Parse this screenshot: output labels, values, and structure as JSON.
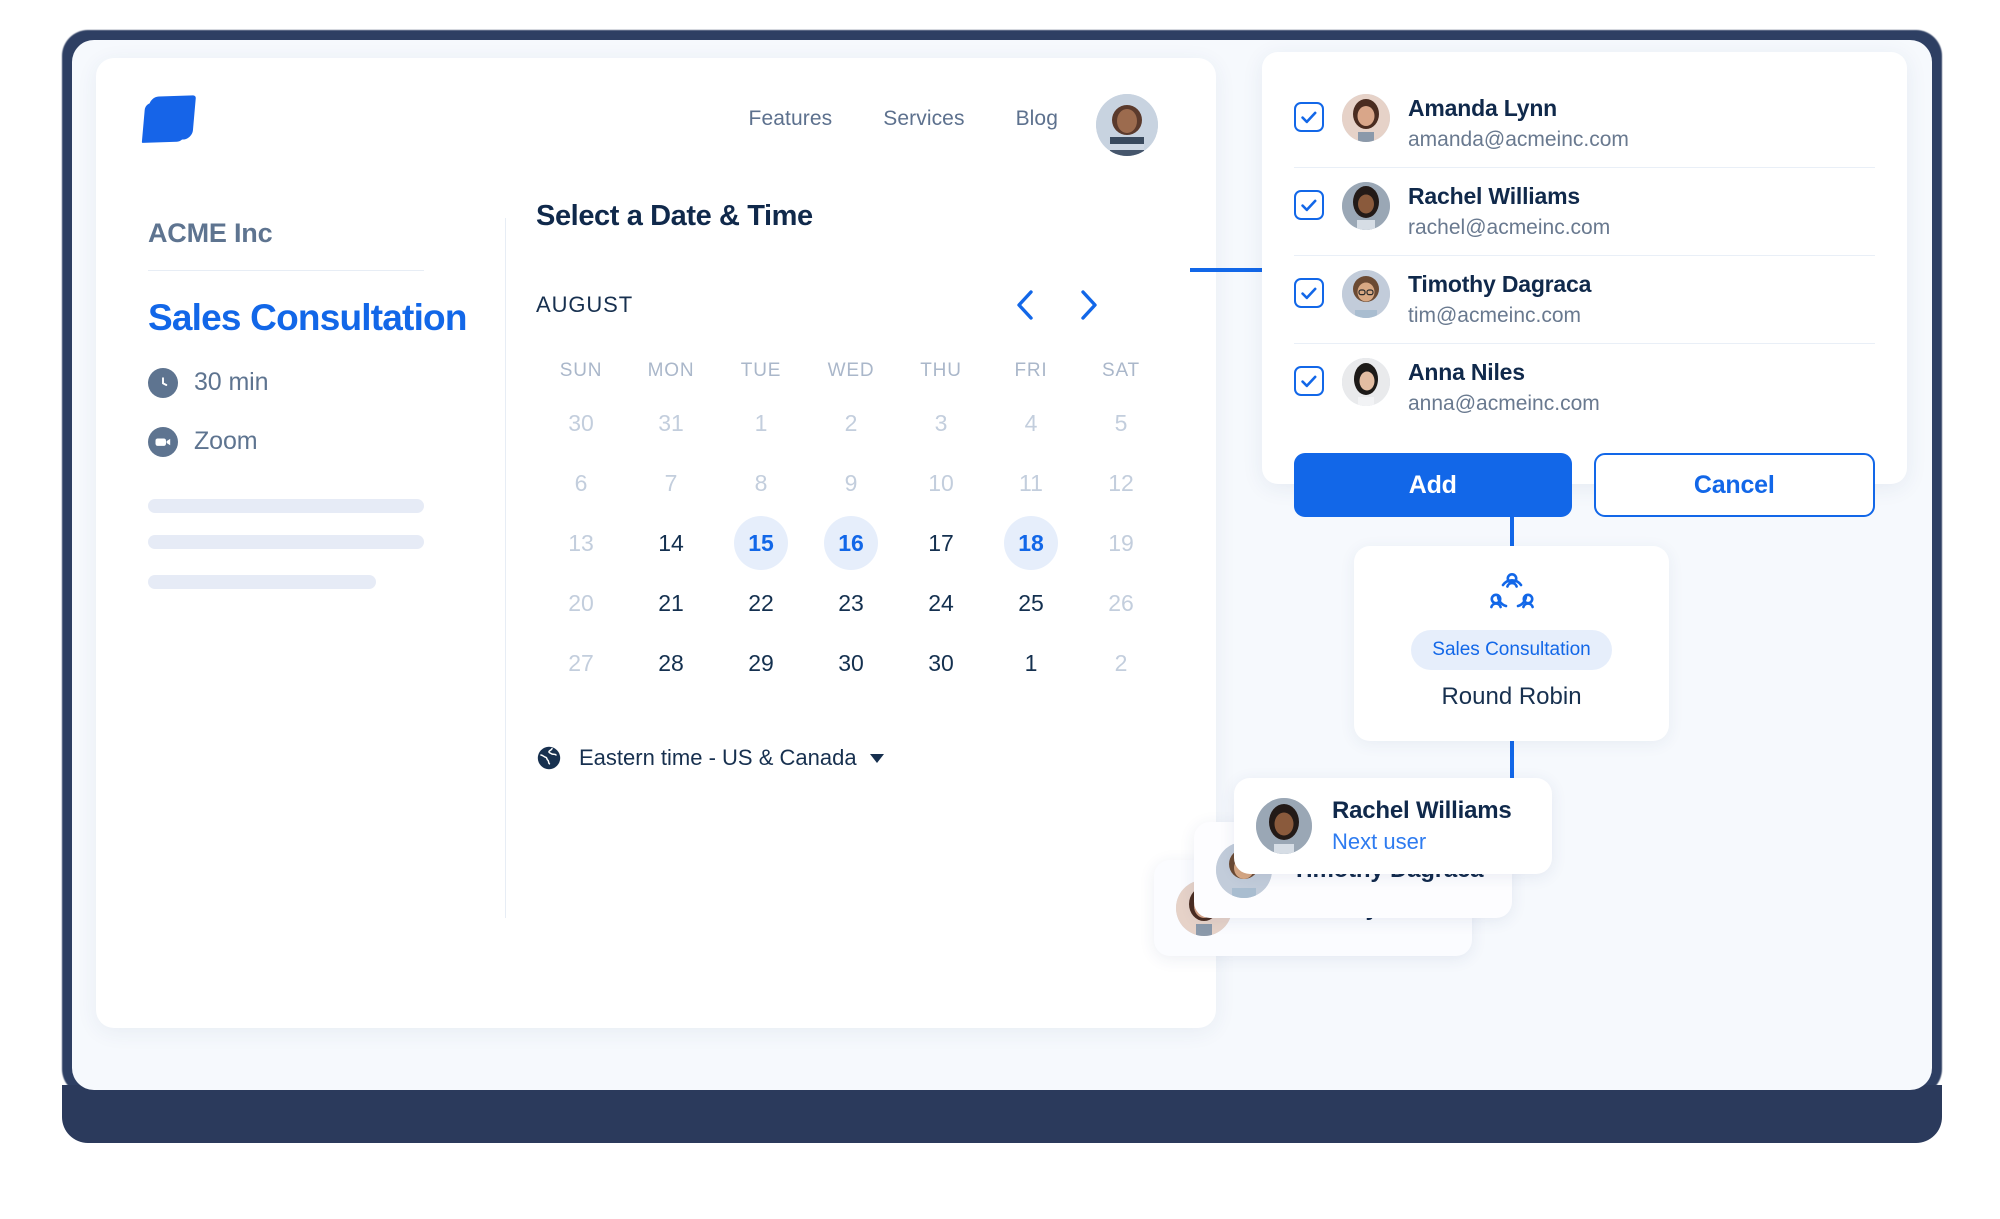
{
  "header": {
    "logo_icon": "brand-logo-icon",
    "nav": [
      {
        "label": "Features"
      },
      {
        "label": "Services"
      },
      {
        "label": "Blog"
      }
    ],
    "avatar_alt": "user-avatar"
  },
  "event": {
    "organization": "ACME Inc",
    "title": "Sales Consultation",
    "duration_icon": "clock-icon",
    "duration": "30 min",
    "location_icon": "video-camera-icon",
    "location": "Zoom"
  },
  "scheduler": {
    "heading": "Select a Date & Time",
    "month": "AUGUST",
    "prev_icon": "chevron-left-icon",
    "next_icon": "chevron-right-icon",
    "weekdays": [
      "SUN",
      "MON",
      "TUE",
      "WED",
      "THU",
      "FRI",
      "SAT"
    ],
    "weeks": [
      [
        {
          "d": "30",
          "state": "muted"
        },
        {
          "d": "31",
          "state": "muted"
        },
        {
          "d": "1",
          "state": "muted"
        },
        {
          "d": "2",
          "state": "muted"
        },
        {
          "d": "3",
          "state": "muted"
        },
        {
          "d": "4",
          "state": "muted"
        },
        {
          "d": "5",
          "state": "muted"
        }
      ],
      [
        {
          "d": "6",
          "state": "muted"
        },
        {
          "d": "7",
          "state": "muted"
        },
        {
          "d": "8",
          "state": "muted"
        },
        {
          "d": "9",
          "state": "muted"
        },
        {
          "d": "10",
          "state": "muted"
        },
        {
          "d": "11",
          "state": "muted"
        },
        {
          "d": "12",
          "state": "muted"
        }
      ],
      [
        {
          "d": "13",
          "state": "muted"
        },
        {
          "d": "14",
          "state": "normal"
        },
        {
          "d": "15",
          "state": "available"
        },
        {
          "d": "16",
          "state": "available"
        },
        {
          "d": "17",
          "state": "normal"
        },
        {
          "d": "18",
          "state": "available"
        },
        {
          "d": "19",
          "state": "muted"
        }
      ],
      [
        {
          "d": "20",
          "state": "muted"
        },
        {
          "d": "21",
          "state": "normal"
        },
        {
          "d": "22",
          "state": "normal"
        },
        {
          "d": "23",
          "state": "normal"
        },
        {
          "d": "24",
          "state": "normal"
        },
        {
          "d": "25",
          "state": "normal"
        },
        {
          "d": "26",
          "state": "muted"
        }
      ],
      [
        {
          "d": "27",
          "state": "muted"
        },
        {
          "d": "28",
          "state": "normal"
        },
        {
          "d": "29",
          "state": "normal"
        },
        {
          "d": "30",
          "state": "normal"
        },
        {
          "d": "30",
          "state": "normal"
        },
        {
          "d": "1",
          "state": "normal"
        },
        {
          "d": "2",
          "state": "muted"
        }
      ]
    ],
    "timezone_icon": "globe-icon",
    "timezone": "Eastern time - US & Canada"
  },
  "members_panel": {
    "members": [
      {
        "name": "Amanda Lynn",
        "email": "amanda@acmeinc.com",
        "checked": true,
        "avatar": "avatar-amanda"
      },
      {
        "name": "Rachel Williams",
        "email": "rachel@acmeinc.com",
        "checked": true,
        "avatar": "avatar-rachel"
      },
      {
        "name": "Timothy Dagraca",
        "email": "tim@acmeinc.com",
        "checked": true,
        "avatar": "avatar-timothy"
      },
      {
        "name": "Anna Niles",
        "email": "anna@acmeinc.com",
        "checked": true,
        "avatar": "avatar-anna"
      }
    ],
    "add_label": "Add",
    "cancel_label": "Cancel"
  },
  "round_robin": {
    "icon": "round-robin-group-icon",
    "pill": "Sales Consultation",
    "label": "Round Robin"
  },
  "assignment_stack": [
    {
      "name": "Rachel Williams",
      "subtitle": "Next user",
      "avatar": "avatar-rachel"
    },
    {
      "name": "Timothy Dagraca",
      "subtitle": "",
      "avatar": "avatar-timothy"
    },
    {
      "name": "Amanda Lynn",
      "subtitle": "",
      "avatar": "avatar-amanda"
    }
  ],
  "colors": {
    "accent": "#1267e8",
    "accent_soft": "#e6eefb",
    "text_dark": "#10294b",
    "text_muted": "#69798f",
    "day_muted": "#c3cedd",
    "device": "#2b3a5c"
  }
}
